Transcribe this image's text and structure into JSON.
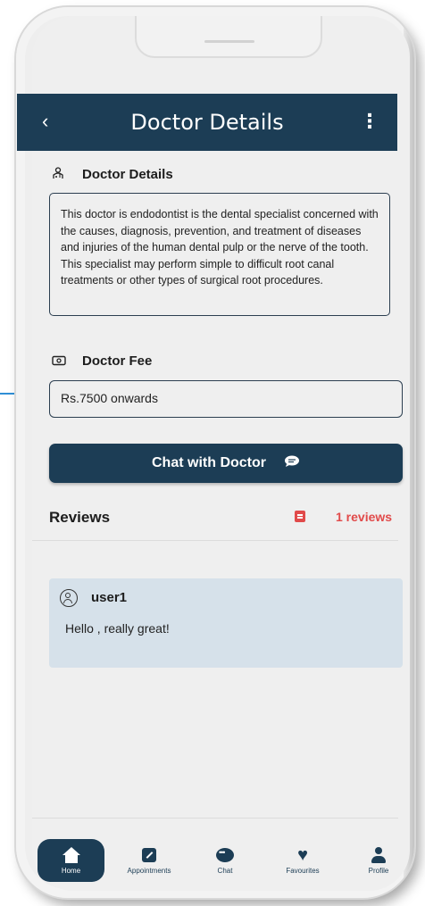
{
  "header": {
    "title": "Doctor Details",
    "back_icon": "‹",
    "more_icon": "⋮"
  },
  "details": {
    "heading": "Doctor Details",
    "description": "This doctor is endodontist is the dental specialist concerned with the causes, diagnosis, prevention, and treatment of diseases and injuries of the human dental pulp or the nerve of the tooth. This specialist may perform simple to difficult root canal treatments or other types of surgical root procedures."
  },
  "fee": {
    "heading": "Doctor Fee",
    "value": "Rs.7500 onwards"
  },
  "chat_button": {
    "label": "Chat with Doctor"
  },
  "reviews": {
    "heading": "Reviews",
    "count_label": "1 reviews",
    "items": [
      {
        "user": "user1",
        "comment": "Hello , really great!"
      }
    ]
  },
  "nav": {
    "items": [
      {
        "label": "Home",
        "icon": "home-icon",
        "active": true
      },
      {
        "label": "Appointments",
        "icon": "pencil-icon"
      },
      {
        "label": "Chat",
        "icon": "chat-icon"
      },
      {
        "label": "Favourites",
        "icon": "heart-icon"
      },
      {
        "label": "Profile",
        "icon": "profile-icon"
      }
    ]
  },
  "colors": {
    "primary": "#1c3d55",
    "accent": "#e14a4a",
    "card": "#d6e1ea"
  }
}
